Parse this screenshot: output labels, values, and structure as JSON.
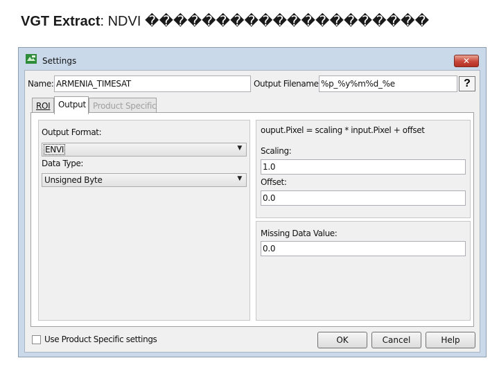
{
  "slide": {
    "title_bold": "VGT Extract",
    "title_rest": ": NDVI ��������������������"
  },
  "dialog": {
    "title": "Settings",
    "close_glyph": "✕",
    "name_label": "Name:",
    "name_value": "ARMENIA_TIMESAT",
    "output_filename_label": "Output Filename:",
    "output_filename_value": "%p_%y%m%d_%e",
    "help_icon_glyph": "?",
    "tabs": [
      {
        "label": "ROI",
        "state": "normal"
      },
      {
        "label": "Output",
        "state": "selected"
      },
      {
        "label": "Product Specific",
        "state": "disabled"
      }
    ],
    "output_tab": {
      "output_format_label": "Output Format:",
      "output_format_value": "ENVI",
      "data_type_label": "Data Type:",
      "data_type_value": "Unsigned Byte",
      "formula": "ouput.Pixel = scaling * input.Pixel + offset",
      "scaling_label": "Scaling:",
      "scaling_value": "1.0",
      "offset_label": "Offset:",
      "offset_value": "0.0",
      "missing_label": "Missing Data Value:",
      "missing_value": "0.0"
    },
    "use_product_specific_label": "Use Product Specific settings",
    "use_product_specific_checked": false,
    "buttons": {
      "ok": "OK",
      "cancel": "Cancel",
      "help": "Help"
    }
  },
  "colors": {
    "window_frame": "#c9d9ea",
    "close_button": "#c8463a",
    "dialog_body": "#f0f0f0"
  }
}
